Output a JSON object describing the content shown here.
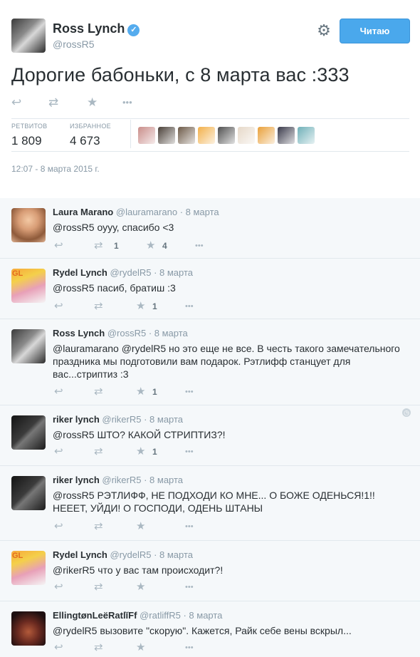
{
  "main_tweet": {
    "author_name": "Ross Lynch",
    "verified_mark": "✓",
    "handle": "@rossR5",
    "follow_label": "Читаю",
    "gear_icon": "gear-icon",
    "text": "Дорогие бабоньки, с 8 марта вас :333",
    "retweets_label": "РЕТВИТОВ",
    "retweets_count": "1 809",
    "favorites_label": "ИЗБРАННОЕ",
    "favorites_count": "4 673",
    "timestamp": "12:07 - 8 марта 2015 г.",
    "favoriter_avatar_colors": [
      "#c98d8a",
      "#4a4038",
      "#6d5a48",
      "#f2b04a",
      "#505050",
      "#e6d8c8",
      "#e9a03a",
      "#3a3a4a",
      "#6fb0b8"
    ]
  },
  "icons": {
    "reply": "↩",
    "retweet": "⇄",
    "favorite": "★",
    "more": "•••",
    "gear": "⚙",
    "globe": "◷"
  },
  "replies": [
    {
      "name": "Laura Marano",
      "handle": "@lauramarano",
      "date": "· 8 марта",
      "text": "@rossR5  оууу, спасибо <3",
      "retweets": "1",
      "favorites": "4"
    },
    {
      "name": "Rydel Lynch",
      "handle": "@rydelR5",
      "date": "· 8 марта",
      "text": "@rossR5  пасиб, братиш :3",
      "retweets": "",
      "favorites": "1",
      "avatar_text": "GL"
    },
    {
      "name": "Ross Lynch",
      "handle": "@rossR5",
      "date": "· 8 марта",
      "text": "@lauramarano @rydelR5 но это еще не все. В честь такого замечательного праздника мы подготовили вам подарок. Рэтлифф станцует для вас...стриптиз :3",
      "retweets": "",
      "favorites": "1"
    },
    {
      "name": "riker lynch",
      "handle": "@rikerR5",
      "date": "· 8 марта",
      "text": "@rossR5  ШТО? КАКОЙ СТРИПТИЗ?!",
      "retweets": "",
      "favorites": "1"
    },
    {
      "name": "riker lynch",
      "handle": "@rikerR5",
      "date": "· 8 марта",
      "text": "@rossR5  РЭТЛИФФ, НЕ ПОДХОДИ КО МНЕ... О БОЖЕ ОДЕНЬСЯ!1!! НЕЕЕТ, УЙДИ! О ГОСПОДИ, ОДЕНЬ ШТАНЫ",
      "retweets": "",
      "favorites": ""
    },
    {
      "name": "Rydel Lynch",
      "handle": "@rydelR5",
      "date": "· 8 марта",
      "text": "@rikerR5 что у вас там происходит?!",
      "retweets": "",
      "favorites": "",
      "avatar_text": "GL"
    },
    {
      "name": "EllingtønLeëRatlĭFf",
      "handle": "@ratliffR5",
      "date": "· 8 марта",
      "text": "@rydelR5 вызовите \"скорую\". Кажется, Райк себе вены вскрыл...",
      "retweets": "",
      "favorites": ""
    }
  ]
}
